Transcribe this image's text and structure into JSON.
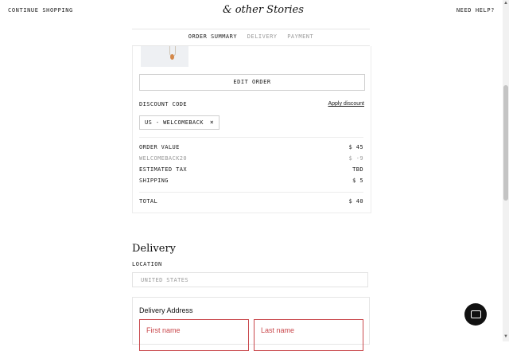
{
  "header": {
    "continue_shopping": "CONTINUE SHOPPING",
    "logo": "& other Stories",
    "need_help": "NEED HELP?"
  },
  "steps": [
    "ORDER SUMMARY",
    "DELIVERY",
    "PAYMENT"
  ],
  "order_summary": {
    "edit_order": "EDIT ORDER",
    "discount_code_label": "DISCOUNT CODE",
    "apply_discount": "Apply discount",
    "applied_code": "US - WELCOMEBACK",
    "remove_symbol": "×",
    "rows": [
      {
        "label": "ORDER VALUE",
        "value": "$ 45"
      },
      {
        "label": "WELCOMEBACK20",
        "value": "$ -9"
      },
      {
        "label": "ESTIMATED TAX",
        "value": "TBD"
      },
      {
        "label": "SHIPPING",
        "value": "$ 5"
      }
    ],
    "total_label": "TOTAL",
    "total_value": "$ 40"
  },
  "delivery": {
    "title": "Delivery",
    "location_label": "LOCATION",
    "location_value": "UNITED STATES",
    "address_title": "Delivery Address",
    "first_name_placeholder": "First name",
    "last_name_placeholder": "Last name"
  },
  "colors": {
    "error_red": "#c9474b",
    "chat_bg": "#111111"
  }
}
